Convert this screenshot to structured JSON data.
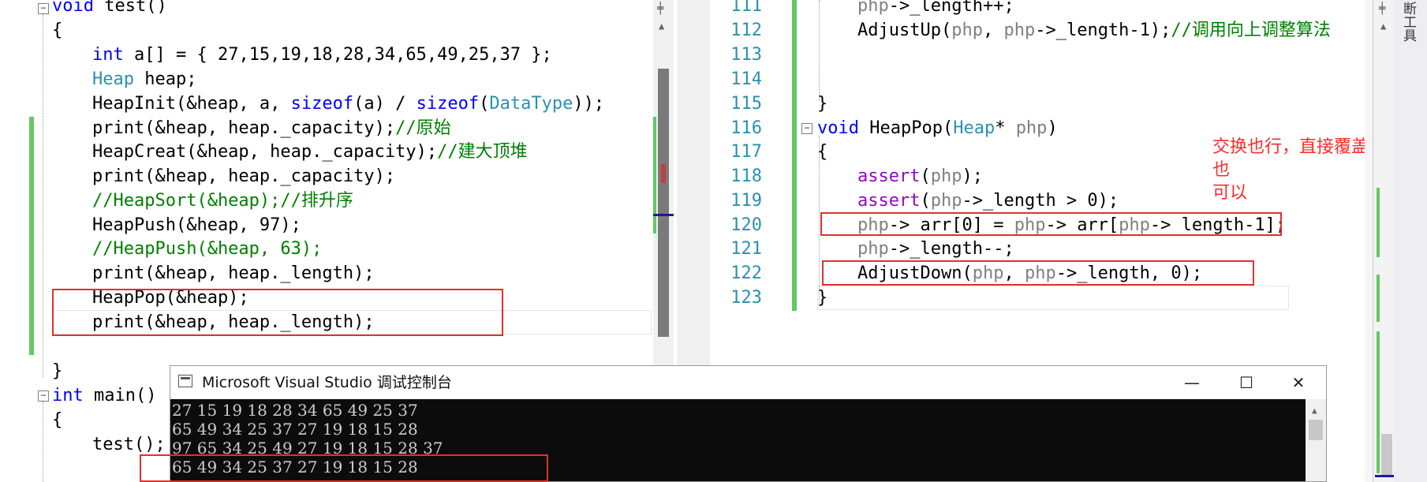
{
  "left_editor": {
    "lines": {
      "l1": [
        "void",
        " test()"
      ],
      "l2": "{",
      "l3": [
        "int",
        " a[] = { 27,15,19,18,28,34,65,49,25,37 };"
      ],
      "l4": [
        "Heap",
        " heap;"
      ],
      "l5": [
        "HeapInit(&heap, a, ",
        "sizeof",
        "(a) / ",
        "sizeof",
        "(",
        "DataType",
        "));"
      ],
      "l6": [
        "print(&heap, heap._capacity);",
        "//原始"
      ],
      "l7": [
        "HeapCreat(&heap, heap._capacity);",
        "//建大顶堆"
      ],
      "l8": "print(&heap, heap._capacity);",
      "l9": "//HeapSort(&heap);//排升序",
      "l10": "HeapPush(&heap, 97);",
      "l11": "//HeapPush(&heap, 63);",
      "l12": "print(&heap, heap._length);",
      "l13": "HeapPop(&heap);",
      "l14": "print(&heap, heap._length);",
      "l15": "}",
      "l16": [
        "int",
        " main()"
      ],
      "l17": "{",
      "l18": "test();"
    }
  },
  "right_editor": {
    "line_numbers": [
      "111",
      "112",
      "113",
      "114",
      "115",
      "116",
      "117",
      "118",
      "119",
      "120",
      "121",
      "122",
      "123"
    ],
    "lines": {
      "r111": [
        "php",
        "->_length++;"
      ],
      "r112": [
        "AdjustUp(",
        "php",
        ", ",
        "php",
        "->_length-1);",
        "//调用向上调整算法"
      ],
      "r115": "}",
      "r116": [
        "void",
        " HeapPop(",
        "Heap",
        "* ",
        "php",
        ")"
      ],
      "r117": "{",
      "r118": [
        "assert",
        "(",
        "php",
        ");"
      ],
      "r119": [
        "assert",
        "(",
        "php",
        "->_length > 0);"
      ],
      "r120": [
        "php",
        "-> arr[0] = ",
        "php",
        "-> arr[",
        "php",
        "-> length-1];"
      ],
      "r121": [
        "php",
        "->_length--;"
      ],
      "r122": [
        "AdjustDown(",
        "php",
        ", ",
        "php",
        "->_length, 0);"
      ],
      "r123": "}"
    },
    "annotation": [
      "交换也行，直接覆盖也",
      "可以"
    ]
  },
  "side_toolbar": {
    "label": "断工具"
  },
  "console": {
    "title": "Microsoft Visual Studio 调试控制台",
    "output": [
      "27 15 19 18 28 34 65 49 25 37",
      "65 49 34 25 37 27 19 18 15 28",
      "97 65 34 25 49 27 19 18 15 28 37",
      "65 49 34 25 37 27 19 18 15 28"
    ],
    "buttons": {
      "minimize": "—",
      "maximize": "☐",
      "close": "✕"
    }
  },
  "colors": {
    "highlight_box": "#e03030",
    "annotation": "#ff2a2a",
    "change_bar": "#63c963"
  }
}
